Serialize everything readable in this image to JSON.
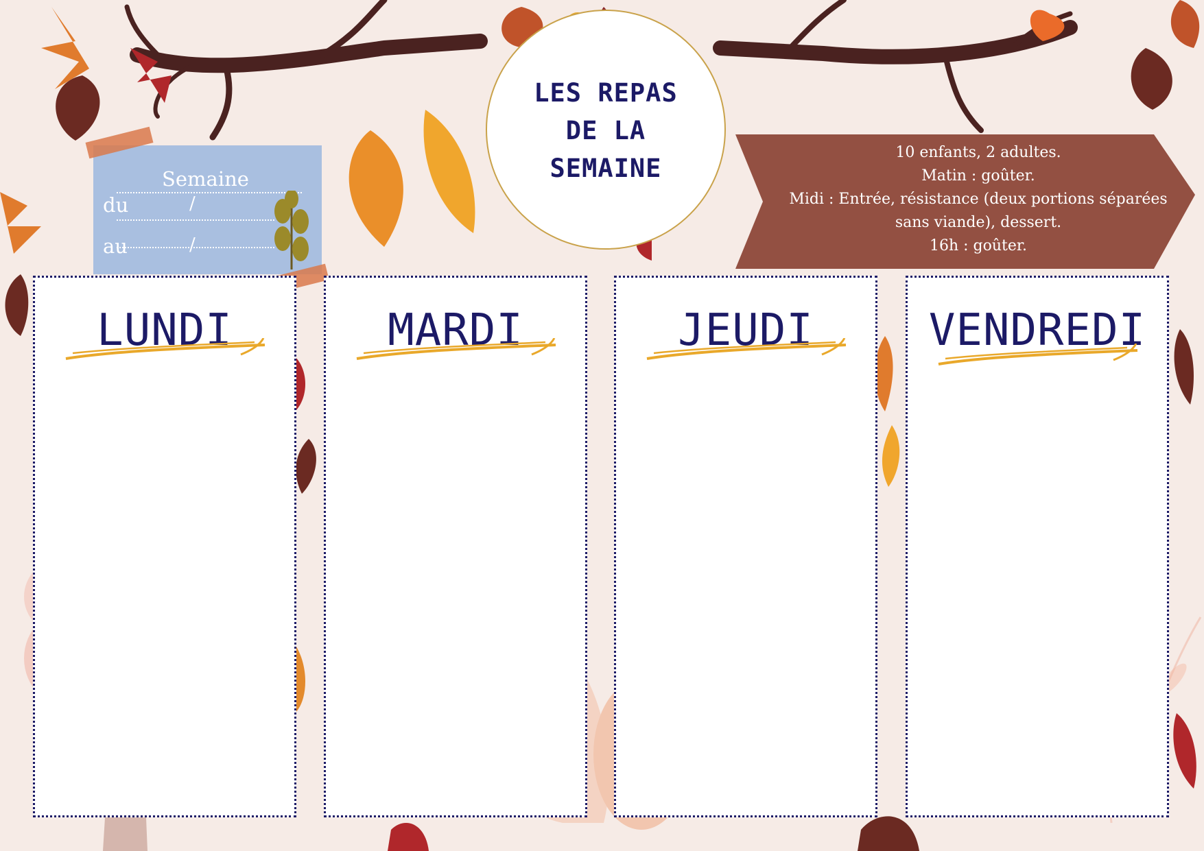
{
  "title": {
    "lines": [
      "LES REPAS",
      "DE LA",
      "SEMAINE"
    ]
  },
  "week": {
    "heading": "Semaine",
    "from_label": "du",
    "to_label": "au",
    "separator": "/"
  },
  "info": {
    "lines": [
      "10 enfants, 2 adultes.",
      "Matin : goûter.",
      "Midi : Entrée, résistance (deux portions séparées",
      "sans viande), dessert.",
      "16h : goûter."
    ]
  },
  "days": [
    "LUNDI",
    "MARDI",
    "JEUDI",
    "VENDREDI"
  ],
  "colors": {
    "title_text": "#1c1a66",
    "banner": "#8f4a3c",
    "week_card": "#a9bfe0",
    "underline": "#e9a82a",
    "background": "#f6ebe6"
  }
}
